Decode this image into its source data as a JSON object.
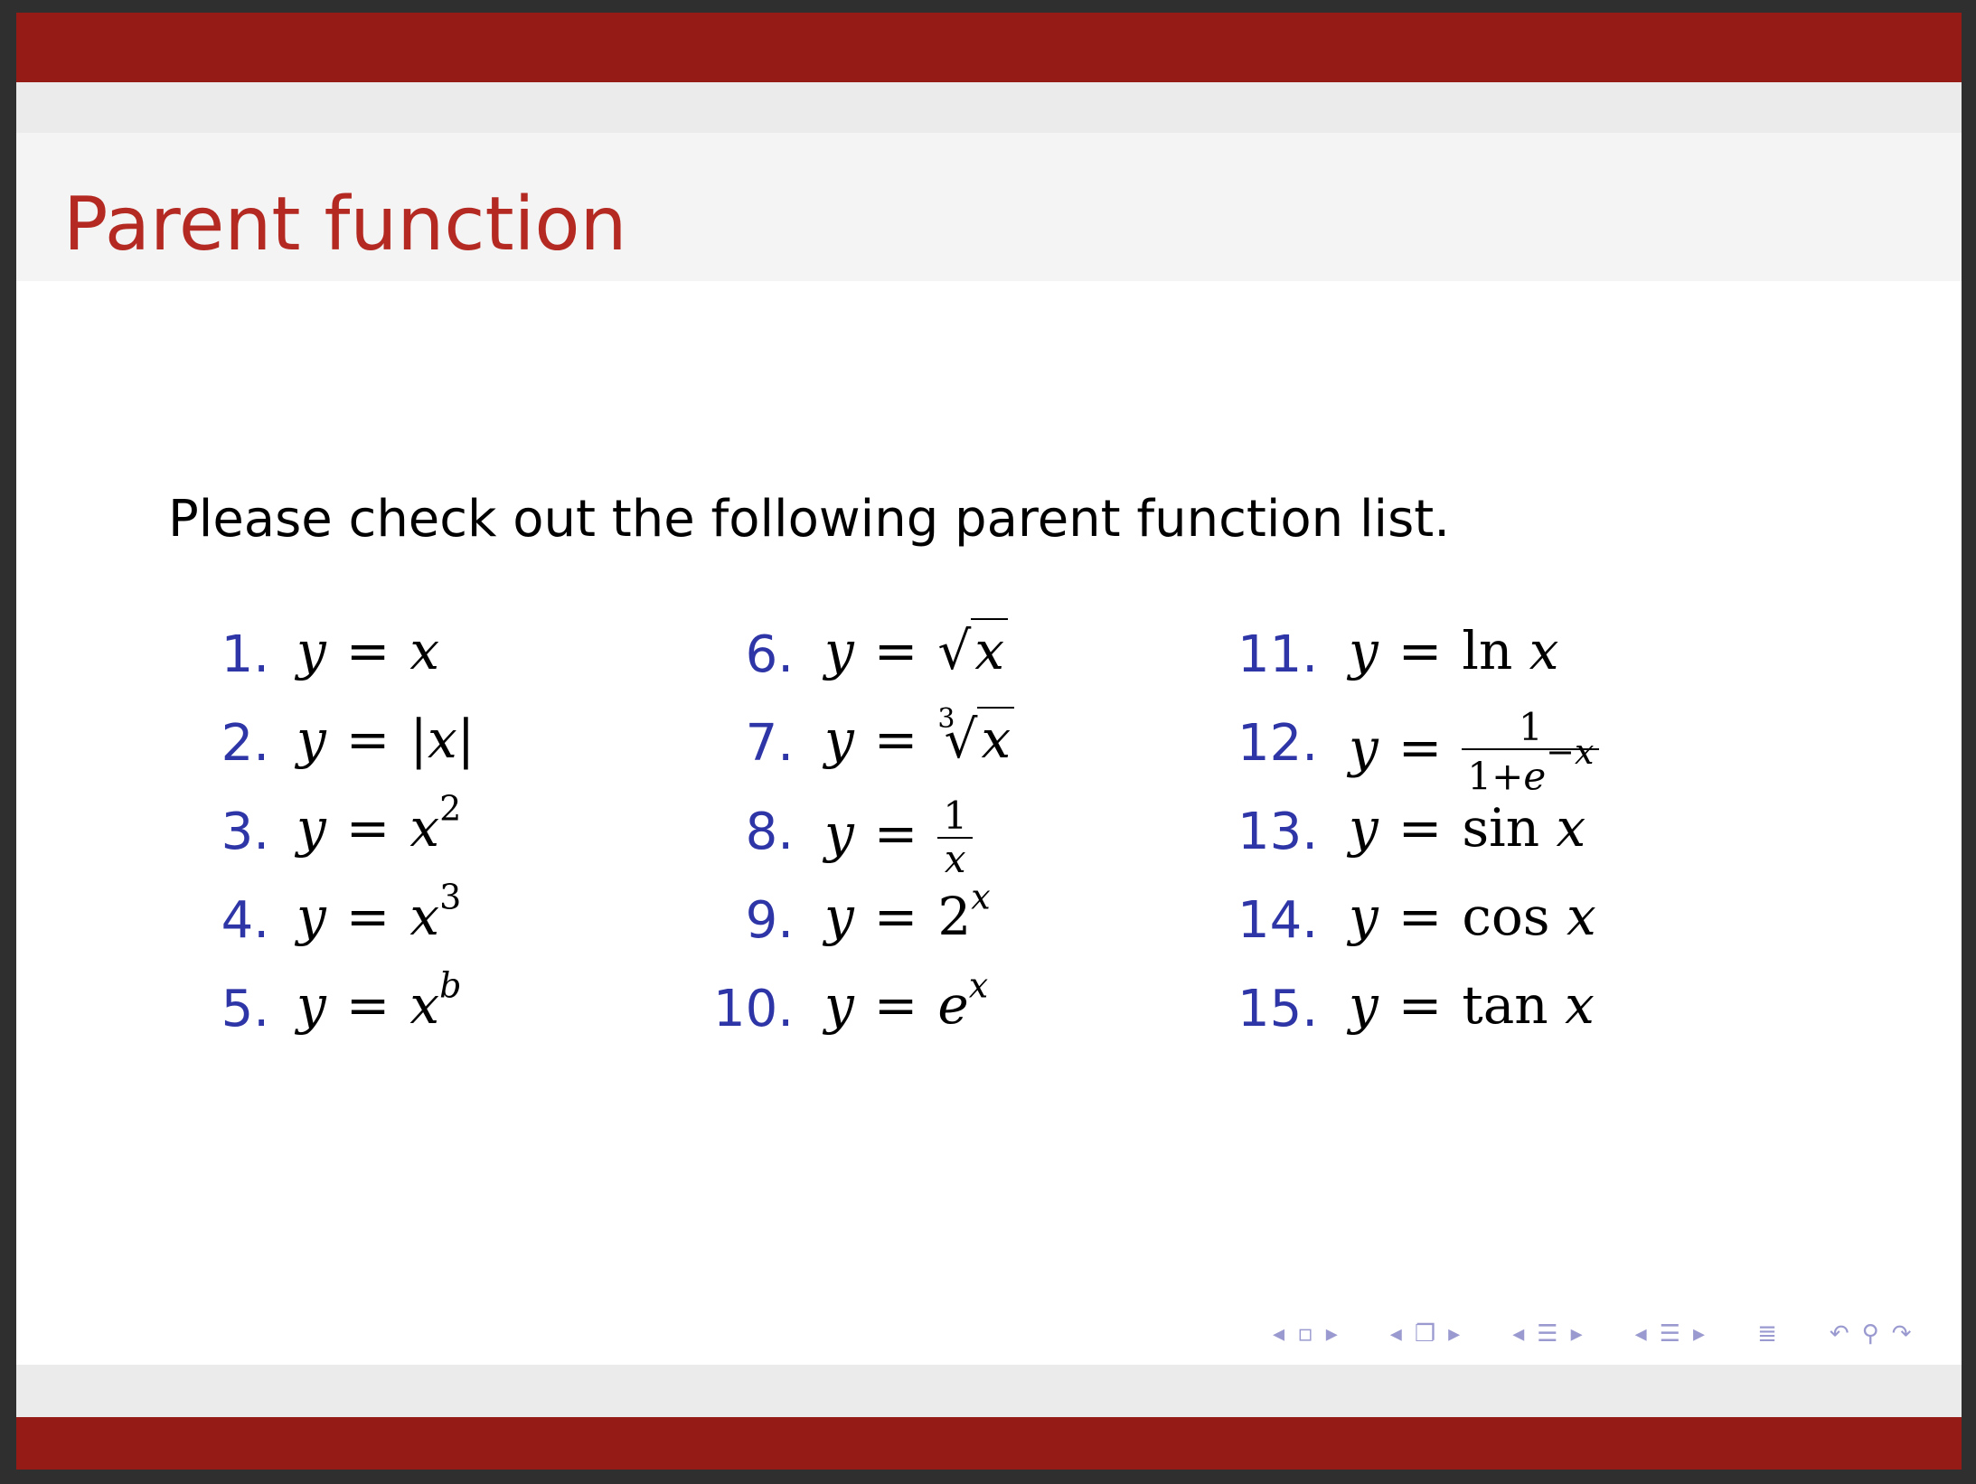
{
  "frame": {
    "title": "Parent function",
    "intro": "Please check out the following parent function list."
  },
  "functions": [
    {
      "num": "1."
    },
    {
      "num": "2."
    },
    {
      "num": "3."
    },
    {
      "num": "4."
    },
    {
      "num": "5."
    },
    {
      "num": "6."
    },
    {
      "num": "7."
    },
    {
      "num": "8."
    },
    {
      "num": "9."
    },
    {
      "num": "10."
    },
    {
      "num": "11."
    },
    {
      "num": "12."
    },
    {
      "num": "13."
    },
    {
      "num": "14."
    },
    {
      "num": "15."
    }
  ],
  "colors": {
    "bar": "#951b16",
    "title": "#b42a22",
    "enumerate": "#2e35a6",
    "nav": "#9a9ad0"
  },
  "navigation": {
    "icons": [
      "arrow-left-icon",
      "frame-icon",
      "arrow-right-icon",
      "arrow-left-icon",
      "subsection-icon",
      "arrow-right-icon",
      "arrow-left-icon",
      "section-icon",
      "arrow-right-icon",
      "arrow-left-icon",
      "presentation-icon",
      "arrow-right-icon",
      "align-icon",
      "undo-icon",
      "search-icon",
      "redo-icon"
    ]
  }
}
